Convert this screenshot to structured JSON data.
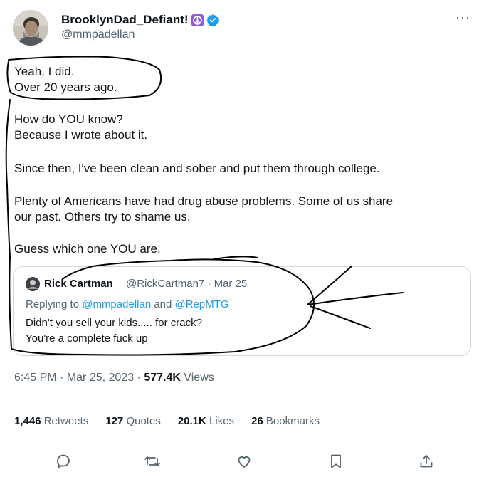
{
  "author": {
    "name": "BrooklynDad_Defiant!",
    "emoji_badge": "☮",
    "verified": true,
    "handle": "@mmpadellan",
    "avatar_icon": "profile-photo"
  },
  "tweet_lines": [
    "Yeah, I did.",
    "Over 20 years ago.",
    "How do YOU know?",
    "Because I wrote about it.",
    "Since then, I've been clean and sober and put them through college.",
    "Plenty of Americans have had drug abuse problems. Some of us share",
    "our past. Others try to shame us.",
    "Guess which one YOU are."
  ],
  "quoted": {
    "name": "Rick Cartman",
    "meta": "@RickCartman7 · Mar 25",
    "replying_prefix": "Replying to",
    "replying_user1": "@mmpadellan",
    "replying_and": "and",
    "replying_user2": "@RepMTG",
    "text_line1": "Didn't you sell your kids..... for crack?",
    "text_line2": "You're a complete fuck up"
  },
  "footer": {
    "time_date": "6:45 PM · Mar 25, 2023 · ",
    "views_count": "577.4K",
    "views_label": " Views"
  },
  "stats": [
    {
      "count": "1,446",
      "label": "Retweets"
    },
    {
      "count": "127",
      "label": "Quotes"
    },
    {
      "count": "20.1K",
      "label": "Likes"
    },
    {
      "count": "26",
      "label": "Bookmarks"
    }
  ],
  "more_label": "···",
  "colors": {
    "text": "#0f1419",
    "secondary": "#536471",
    "link": "#1d9bf0",
    "verified": "#1d9bf0",
    "badge": "#8e5cd9",
    "marker": "#000000"
  },
  "actions": [
    "reply-icon",
    "retweet-icon",
    "like-icon",
    "bookmark-icon",
    "share-icon"
  ]
}
